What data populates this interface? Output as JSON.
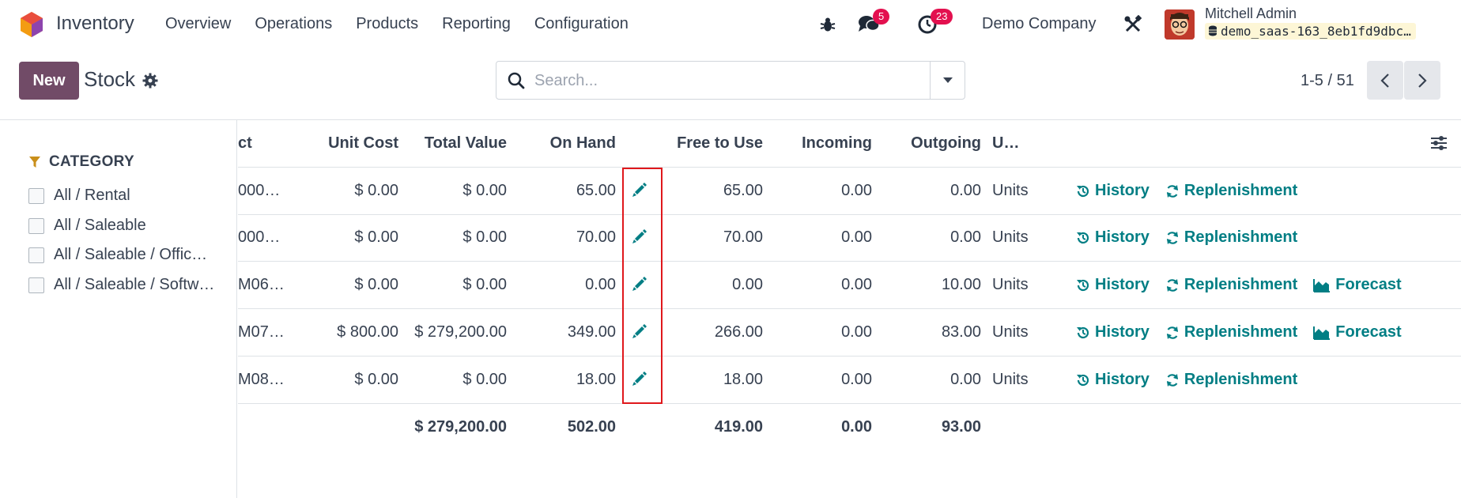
{
  "app": {
    "name": "Inventory"
  },
  "menu": [
    "Overview",
    "Operations",
    "Products",
    "Reporting",
    "Configuration"
  ],
  "systray": {
    "messages_count": "5",
    "activities_count": "23",
    "company": "Demo Company",
    "user": "Mitchell Admin",
    "database": "demo_saas-163_8eb1fd9dbc…"
  },
  "control": {
    "new_label": "New",
    "title": "Stock",
    "search_placeholder": "Search...",
    "pager": "1-5 / 51"
  },
  "sidebar": {
    "title": "CATEGORY",
    "items": [
      "All / Rental",
      "All / Saleable",
      "All / Saleable / Offic…",
      "All / Saleable / Softw…"
    ]
  },
  "table": {
    "headers": {
      "product": "ct",
      "unit_cost": "Unit Cost",
      "total_value": "Total Value",
      "on_hand": "On Hand",
      "free": "Free to Use",
      "incoming": "Incoming",
      "outgoing": "Outgoing",
      "uom": "U…"
    },
    "rows": [
      {
        "product": "000…",
        "unit_cost": "$ 0.00",
        "total_value": "$ 0.00",
        "on_hand": "65.00",
        "free": "65.00",
        "incoming": "0.00",
        "outgoing": "0.00",
        "uom": "Units",
        "forecast": false
      },
      {
        "product": "000…",
        "unit_cost": "$ 0.00",
        "total_value": "$ 0.00",
        "on_hand": "70.00",
        "free": "70.00",
        "incoming": "0.00",
        "outgoing": "0.00",
        "uom": "Units",
        "forecast": false
      },
      {
        "product": "M06…",
        "unit_cost": "$ 0.00",
        "total_value": "$ 0.00",
        "on_hand": "0.00",
        "free": "0.00",
        "incoming": "0.00",
        "outgoing": "10.00",
        "uom": "Units",
        "forecast": true
      },
      {
        "product": "M07…",
        "unit_cost": "$ 800.00",
        "total_value": "$ 279,200.00",
        "on_hand": "349.00",
        "free": "266.00",
        "incoming": "0.00",
        "outgoing": "83.00",
        "uom": "Units",
        "forecast": true
      },
      {
        "product": "M08…",
        "unit_cost": "$ 0.00",
        "total_value": "$ 0.00",
        "on_hand": "18.00",
        "free": "18.00",
        "incoming": "0.00",
        "outgoing": "0.00",
        "uom": "Units",
        "forecast": false
      }
    ],
    "actions": {
      "history": "History",
      "replenishment": "Replenishment",
      "forecast": "Forecast"
    },
    "totals": {
      "total_value": "$ 279,200.00",
      "on_hand": "502.00",
      "free": "419.00",
      "incoming": "0.00",
      "outgoing": "93.00"
    }
  },
  "colors": {
    "brand": "#714b67",
    "link": "#017e84",
    "badge": "#e3104f",
    "highlight": "#e0181c"
  }
}
